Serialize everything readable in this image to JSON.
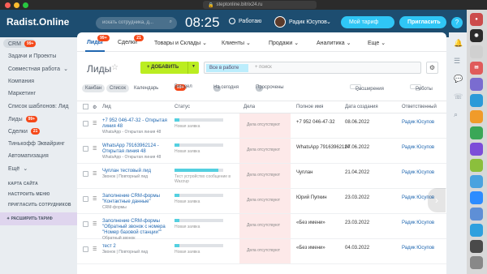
{
  "browser": {
    "url": "steptonline.bitrix24.ru",
    "title": "Лиды"
  },
  "topbar": {
    "logo": "Radist.Online",
    "search_placeholder": "искать сотрудника, д...",
    "time": "08:25",
    "work_label": "Работаю",
    "user_name": "Радик Юсупов",
    "plan_label": "Мой тариф",
    "invite_label": "Пригласить",
    "help": "?"
  },
  "sidebar": {
    "crm": {
      "label": "CRM",
      "badge": "99+"
    },
    "items": [
      {
        "label": "Задачи и Проекты",
        "badge": ""
      },
      {
        "label": "Совместная работа",
        "badge": "",
        "chev": "⌄"
      },
      {
        "label": "Компания",
        "badge": ""
      },
      {
        "label": "Маркетинг",
        "badge": ""
      },
      {
        "label": "Список шаблонов: Лид",
        "badge": ""
      },
      {
        "label": "Лиды",
        "badge": "99+"
      },
      {
        "label": "Сделки",
        "badge": "21"
      },
      {
        "label": "Тинькофф Эквайринг",
        "badge": ""
      },
      {
        "label": "Автоматизация",
        "badge": ""
      },
      {
        "label": "Ещё",
        "badge": "",
        "chev": "⌄"
      }
    ],
    "small": [
      "КАРТА САЙТА",
      "НАСТРОИТЬ МЕНЮ",
      "ПРИГЛАСИТЬ СОТРУДНИКОВ"
    ],
    "tariff": "РАСШИРИТЬ ТАРИФ"
  },
  "tabs": [
    {
      "label": "Лиды",
      "badge": "99+"
    },
    {
      "label": "Сделки",
      "badge": "21"
    },
    {
      "label": "Товары и Склады",
      "chev": "⌄"
    },
    {
      "label": "Клиенты",
      "chev": "⌄"
    },
    {
      "label": "Продажи",
      "chev": "⌄"
    },
    {
      "label": "Аналитика",
      "chev": "⌄"
    },
    {
      "label": "Еще",
      "chev": "⌄"
    }
  ],
  "page": {
    "title": "Лиды",
    "add_label": "+ ДОБАВИТЬ",
    "filter_chip": "Все в работе",
    "filter_search": "+ поиск"
  },
  "views": {
    "items": [
      "Канбан",
      "Список",
      "Календарь"
    ],
    "counter1_badge": "99+",
    "counter1": "Без дел",
    "counter2_badge": "0",
    "counter2": "На сегодня",
    "counter3_badge": "0",
    "counter3": "Просрочены",
    "extensions": "Расширения",
    "robots": "Роботы"
  },
  "columns": [
    "Лид",
    "Статус",
    "Дела",
    "Полное имя",
    "Дата создания",
    "Ответственный"
  ],
  "rows": [
    {
      "name": "+7 952 046-47-32 - Открытая линия 48",
      "sub": "WhatsApp - Открытая линия 48",
      "progress": 0.1,
      "status": "Новая заявка",
      "deals": "Дела отсутствуют",
      "fullname": "+7 952 046-47-32",
      "date": "08.06.2022",
      "resp": "Радик Юсупов"
    },
    {
      "name": "WhatsApp 79163962124 - Открытая линия 48",
      "sub": "WhatsApp - Открытая линия 48",
      "progress": 0.1,
      "status": "Новая заявка",
      "deals": "Дела отсутствуют",
      "fullname": "WhatsApp 79163962124",
      "date": "07.06.2022",
      "resp": "Радик Юсупов"
    },
    {
      "name": "Чуплан тестовый лид",
      "sub": "Звонок | Повторный лид",
      "progress": 0.9,
      "status": "Тест устройство сообщение в Wazzup",
      "deals": "Дела отсутствуют",
      "fullname": "Чуплан",
      "date": "21.04.2022",
      "resp": "Радик Юсупов"
    },
    {
      "name": "Заполнение CRM-формы \"Контактные данные\"",
      "sub": "CRM-формы",
      "progress": 0.1,
      "status": "Новая заявка",
      "deals": "Дела отсутствуют",
      "fullname": "Юрий Пупкин",
      "date": "23.03.2022",
      "resp": "Радик Юсупов"
    },
    {
      "name": "Заполнение CRM-формы \"Обратный звонок с номера \"Номер базовой станции\"\"",
      "sub": "Обратный звонок",
      "progress": 0.1,
      "status": "Новая заявка",
      "deals": "Дела отсутствуют",
      "fullname": "«Без имени»",
      "date": "23.03.2022",
      "resp": "Радик Юсупов"
    },
    {
      "name": "тест 2",
      "sub": "Звонок | Повторный лид",
      "progress": 0.1,
      "status": "Новая заявка",
      "deals": "Дела отсутствуют",
      "fullname": "«Без имени»",
      "date": "04.03.2022",
      "resp": "Радик Юсупов"
    }
  ],
  "colors": {
    "accent": "#2fc6f6",
    "add": "#bbed21",
    "badge": "#f54819",
    "topbar": "#1d4d70"
  }
}
